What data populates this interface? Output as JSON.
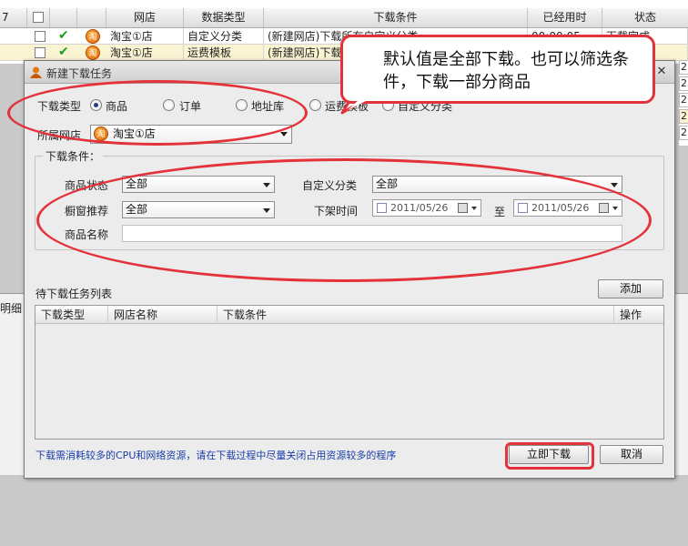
{
  "background_grid": {
    "header_row_num": "7",
    "columns": [
      "网店",
      "数据类型",
      "下载条件",
      "已经用时",
      "状态"
    ],
    "rows": [
      {
        "shop": "淘宝①店",
        "type": "自定义分类",
        "condition": "(新建网店)下载所有自定义分类",
        "elapsed": "00:00:05",
        "status": "下载完成"
      },
      {
        "shop": "淘宝①店",
        "type": "运费模板",
        "condition": "(新建网店)下载所有运费模板",
        "elapsed": "",
        "status": ""
      }
    ],
    "right_strip": [
      "2",
      "2",
      "2",
      "2",
      "2",
      "2"
    ],
    "left_label": "明细"
  },
  "dialog": {
    "title": "新建下载任务",
    "download_type_label": "下载类型",
    "download_types": [
      "商品",
      "订单",
      "地址库",
      "运费模板",
      "自定义分类"
    ],
    "selected_type_index": 0,
    "shop_label": "所属网店",
    "shop_value": "淘宝①店",
    "conditions_group_title": "下载条件：",
    "product_status_label": "商品状态",
    "product_status_value": "全部",
    "custom_category_label": "自定义分类",
    "custom_category_value": "全部",
    "window_recommend_label": "橱窗推荐",
    "window_recommend_value": "全部",
    "offshelf_time_label": "下架时间",
    "date_from": "2011/05/26",
    "to_label": "至",
    "date_to": "2011/05/26",
    "product_name_label": "商品名称",
    "product_name_value": "",
    "task_list_title": "待下载任务列表",
    "add_button": "添加",
    "task_columns": [
      "下载类型",
      "网店名称",
      "下载条件",
      "操作"
    ],
    "tip": "下载需消耗较多的CPU和网络资源，请在下载过程中尽量关闭占用资源较多的程序",
    "download_now_button": "立即下载",
    "cancel_button": "取消"
  },
  "annotation": {
    "callout_text": "默认值是全部下载。也可以筛选条件，下载一部分商品",
    "color": "#e3323a"
  }
}
